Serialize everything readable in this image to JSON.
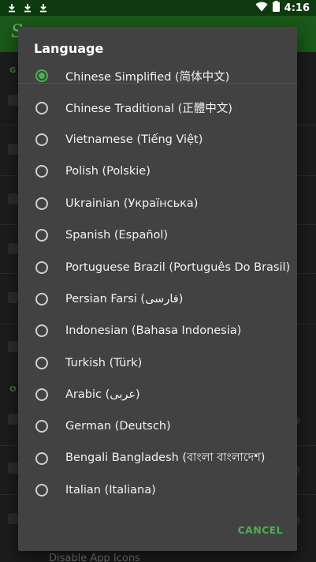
{
  "status_bar": {
    "time": "4:16"
  },
  "app": {
    "title_fragment": "S",
    "section_a": "G",
    "section_b": "O",
    "bottom_item": "Disable App Icons"
  },
  "dialog": {
    "title": "Language",
    "cancel_label": "CANCEL",
    "options": [
      {
        "label": "Chinese Simplified (简体中文)",
        "selected": true
      },
      {
        "label": "Chinese Traditional (正體中文)",
        "selected": false
      },
      {
        "label": "Vietnamese (Tiếng Việt)",
        "selected": false
      },
      {
        "label": "Polish (Polskie)",
        "selected": false
      },
      {
        "label": "Ukrainian (Українська)",
        "selected": false
      },
      {
        "label": "Spanish (Español)",
        "selected": false
      },
      {
        "label": "Portuguese Brazil (Português Do Brasil)",
        "selected": false
      },
      {
        "label": "Persian Farsi (فارسی)",
        "selected": false
      },
      {
        "label": "Indonesian (Bahasa Indonesia)",
        "selected": false
      },
      {
        "label": "Turkish (Türk)",
        "selected": false
      },
      {
        "label": "Arabic (عربى)",
        "selected": false
      },
      {
        "label": "German (Deutsch)",
        "selected": false
      },
      {
        "label": "Bengali Bangladesh (বাংলা বাংলাদেশ)",
        "selected": false
      },
      {
        "label": "Italian (Italiana)",
        "selected": false
      }
    ]
  },
  "colors": {
    "accent": "#4caf50",
    "dialog_bg": "#424242",
    "toolbar": "#1a5a1a"
  }
}
